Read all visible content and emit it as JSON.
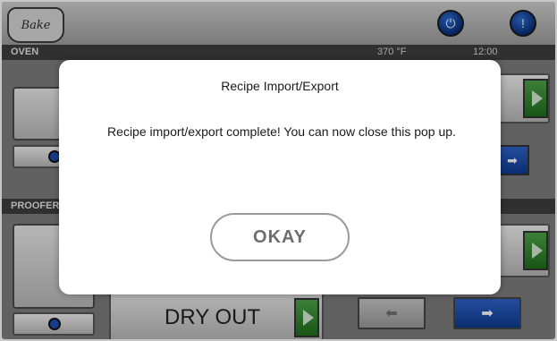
{
  "app": {
    "logo_text": "Bake"
  },
  "header": {
    "power_icon": "power-icon",
    "alert_icon": "alert-icon"
  },
  "oven": {
    "label": "OVEN",
    "temperature": "370 °F",
    "timer": "12:00"
  },
  "proofer": {
    "label": "PROOFER"
  },
  "bottom": {
    "dry_out_label": "DRY OUT"
  },
  "modal": {
    "title": "Recipe Import/Export",
    "message": "Recipe import/export complete! You can now close this pop up.",
    "okay_label": "OKAY"
  },
  "colors": {
    "accent_blue": "#1c4fb0",
    "accent_green": "#2f8a2b",
    "modal_bg": "#ffffff"
  }
}
